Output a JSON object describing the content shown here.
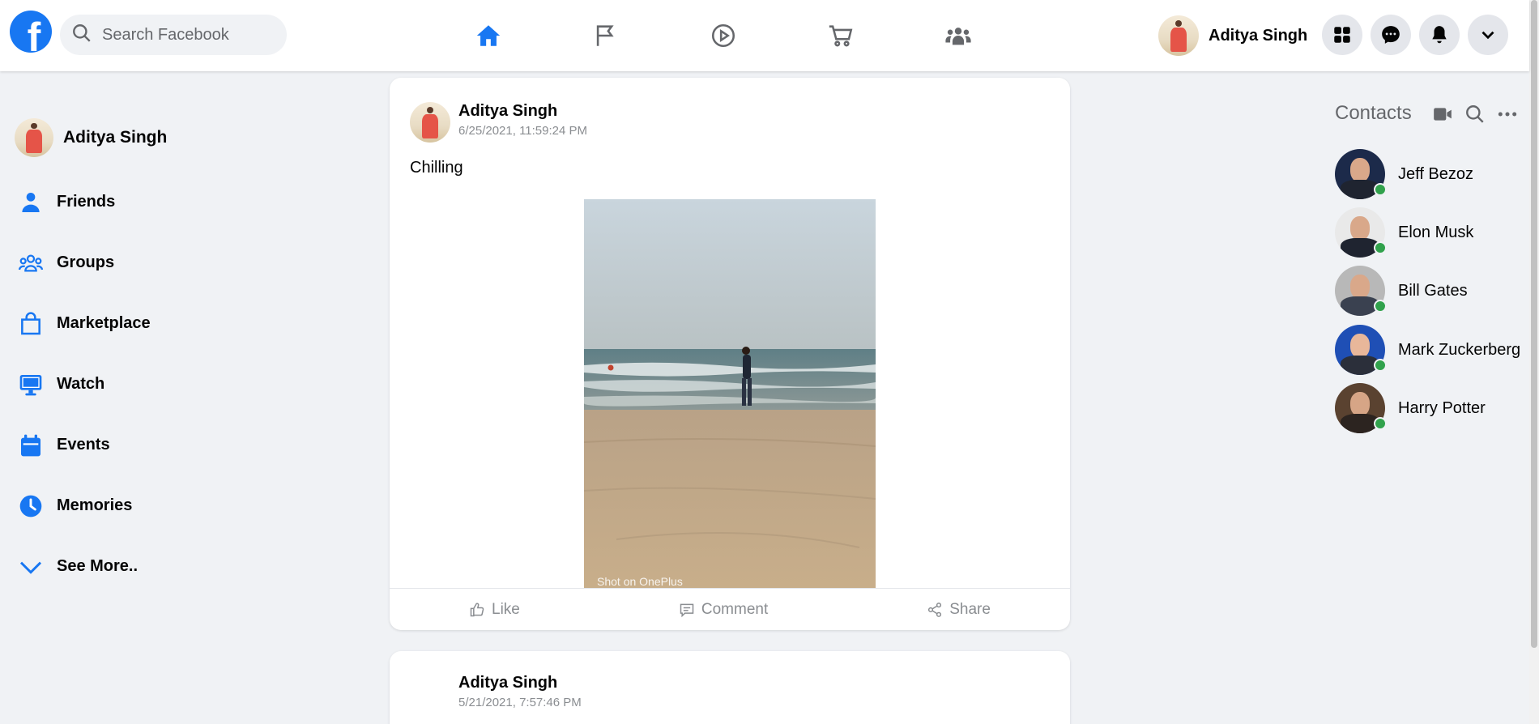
{
  "header": {
    "search_placeholder": "Search Facebook",
    "user_name": "Aditya Singh",
    "nav": [
      "home-icon",
      "flag-icon",
      "watch-icon",
      "marketplace-icon",
      "groups-icon"
    ],
    "active_nav": "home-icon",
    "accent": "#1877f2"
  },
  "sidebar": {
    "profile_name": "Aditya Singh",
    "items": [
      {
        "label": "Friends",
        "icon": "friends-icon"
      },
      {
        "label": "Groups",
        "icon": "groups-icon"
      },
      {
        "label": "Marketplace",
        "icon": "marketplace-bag-icon"
      },
      {
        "label": "Watch",
        "icon": "monitor-icon"
      },
      {
        "label": "Events",
        "icon": "calendar-icon"
      },
      {
        "label": "Memories",
        "icon": "clock-icon"
      },
      {
        "label": "See More..",
        "icon": "chevron-down-icon"
      }
    ]
  },
  "posts": [
    {
      "author": "Aditya Singh",
      "timestamp": "6/25/2021, 11:59:24 PM",
      "text": "Chilling",
      "photo_watermark": "Shot on OnePlus",
      "actions": {
        "like": "Like",
        "comment": "Comment",
        "share": "Share"
      }
    },
    {
      "author": "Aditya Singh",
      "timestamp": "5/21/2021, 7:57:46 PM"
    }
  ],
  "contacts": {
    "title": "Contacts",
    "list": [
      {
        "name": "Jeff Bezoz",
        "online": true,
        "bg": "#1c2a4a"
      },
      {
        "name": "Elon Musk",
        "online": true,
        "bg": "#e9e9e9"
      },
      {
        "name": "Bill Gates",
        "online": true,
        "bg": "#b8b8b8"
      },
      {
        "name": "Mark Zuckerberg",
        "online": true,
        "bg": "#1f4fb5"
      },
      {
        "name": "Harry Potter",
        "online": true,
        "bg": "#5a4230"
      }
    ]
  }
}
